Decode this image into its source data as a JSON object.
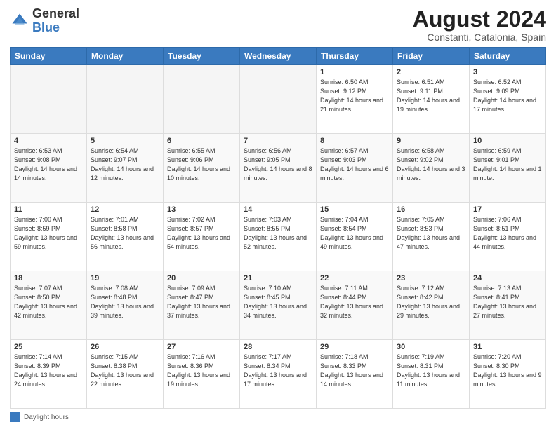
{
  "header": {
    "logo_general": "General",
    "logo_blue": "Blue",
    "title": "August 2024",
    "subtitle": "Constanti, Catalonia, Spain"
  },
  "days_of_week": [
    "Sunday",
    "Monday",
    "Tuesday",
    "Wednesday",
    "Thursday",
    "Friday",
    "Saturday"
  ],
  "weeks": [
    [
      {
        "day": "",
        "info": ""
      },
      {
        "day": "",
        "info": ""
      },
      {
        "day": "",
        "info": ""
      },
      {
        "day": "",
        "info": ""
      },
      {
        "day": "1",
        "info": "Sunrise: 6:50 AM\nSunset: 9:12 PM\nDaylight: 14 hours and 21 minutes."
      },
      {
        "day": "2",
        "info": "Sunrise: 6:51 AM\nSunset: 9:11 PM\nDaylight: 14 hours and 19 minutes."
      },
      {
        "day": "3",
        "info": "Sunrise: 6:52 AM\nSunset: 9:09 PM\nDaylight: 14 hours and 17 minutes."
      }
    ],
    [
      {
        "day": "4",
        "info": "Sunrise: 6:53 AM\nSunset: 9:08 PM\nDaylight: 14 hours and 14 minutes."
      },
      {
        "day": "5",
        "info": "Sunrise: 6:54 AM\nSunset: 9:07 PM\nDaylight: 14 hours and 12 minutes."
      },
      {
        "day": "6",
        "info": "Sunrise: 6:55 AM\nSunset: 9:06 PM\nDaylight: 14 hours and 10 minutes."
      },
      {
        "day": "7",
        "info": "Sunrise: 6:56 AM\nSunset: 9:05 PM\nDaylight: 14 hours and 8 minutes."
      },
      {
        "day": "8",
        "info": "Sunrise: 6:57 AM\nSunset: 9:03 PM\nDaylight: 14 hours and 6 minutes."
      },
      {
        "day": "9",
        "info": "Sunrise: 6:58 AM\nSunset: 9:02 PM\nDaylight: 14 hours and 3 minutes."
      },
      {
        "day": "10",
        "info": "Sunrise: 6:59 AM\nSunset: 9:01 PM\nDaylight: 14 hours and 1 minute."
      }
    ],
    [
      {
        "day": "11",
        "info": "Sunrise: 7:00 AM\nSunset: 8:59 PM\nDaylight: 13 hours and 59 minutes."
      },
      {
        "day": "12",
        "info": "Sunrise: 7:01 AM\nSunset: 8:58 PM\nDaylight: 13 hours and 56 minutes."
      },
      {
        "day": "13",
        "info": "Sunrise: 7:02 AM\nSunset: 8:57 PM\nDaylight: 13 hours and 54 minutes."
      },
      {
        "day": "14",
        "info": "Sunrise: 7:03 AM\nSunset: 8:55 PM\nDaylight: 13 hours and 52 minutes."
      },
      {
        "day": "15",
        "info": "Sunrise: 7:04 AM\nSunset: 8:54 PM\nDaylight: 13 hours and 49 minutes."
      },
      {
        "day": "16",
        "info": "Sunrise: 7:05 AM\nSunset: 8:53 PM\nDaylight: 13 hours and 47 minutes."
      },
      {
        "day": "17",
        "info": "Sunrise: 7:06 AM\nSunset: 8:51 PM\nDaylight: 13 hours and 44 minutes."
      }
    ],
    [
      {
        "day": "18",
        "info": "Sunrise: 7:07 AM\nSunset: 8:50 PM\nDaylight: 13 hours and 42 minutes."
      },
      {
        "day": "19",
        "info": "Sunrise: 7:08 AM\nSunset: 8:48 PM\nDaylight: 13 hours and 39 minutes."
      },
      {
        "day": "20",
        "info": "Sunrise: 7:09 AM\nSunset: 8:47 PM\nDaylight: 13 hours and 37 minutes."
      },
      {
        "day": "21",
        "info": "Sunrise: 7:10 AM\nSunset: 8:45 PM\nDaylight: 13 hours and 34 minutes."
      },
      {
        "day": "22",
        "info": "Sunrise: 7:11 AM\nSunset: 8:44 PM\nDaylight: 13 hours and 32 minutes."
      },
      {
        "day": "23",
        "info": "Sunrise: 7:12 AM\nSunset: 8:42 PM\nDaylight: 13 hours and 29 minutes."
      },
      {
        "day": "24",
        "info": "Sunrise: 7:13 AM\nSunset: 8:41 PM\nDaylight: 13 hours and 27 minutes."
      }
    ],
    [
      {
        "day": "25",
        "info": "Sunrise: 7:14 AM\nSunset: 8:39 PM\nDaylight: 13 hours and 24 minutes."
      },
      {
        "day": "26",
        "info": "Sunrise: 7:15 AM\nSunset: 8:38 PM\nDaylight: 13 hours and 22 minutes."
      },
      {
        "day": "27",
        "info": "Sunrise: 7:16 AM\nSunset: 8:36 PM\nDaylight: 13 hours and 19 minutes."
      },
      {
        "day": "28",
        "info": "Sunrise: 7:17 AM\nSunset: 8:34 PM\nDaylight: 13 hours and 17 minutes."
      },
      {
        "day": "29",
        "info": "Sunrise: 7:18 AM\nSunset: 8:33 PM\nDaylight: 13 hours and 14 minutes."
      },
      {
        "day": "30",
        "info": "Sunrise: 7:19 AM\nSunset: 8:31 PM\nDaylight: 13 hours and 11 minutes."
      },
      {
        "day": "31",
        "info": "Sunrise: 7:20 AM\nSunset: 8:30 PM\nDaylight: 13 hours and 9 minutes."
      }
    ]
  ],
  "legend": {
    "label": "Daylight hours"
  }
}
